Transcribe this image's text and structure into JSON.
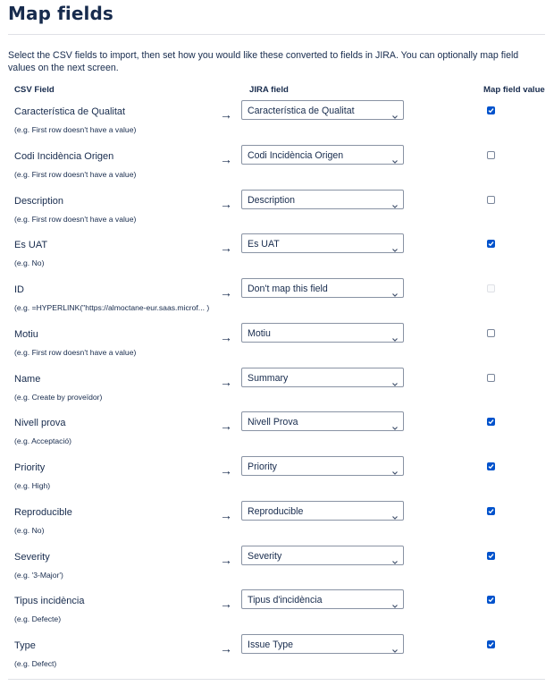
{
  "page": {
    "title": "Map fields",
    "intro": "Select the CSV fields to import, then set how you would like these converted to fields in JIRA. You can optionally map field values on the next screen."
  },
  "columns": {
    "csv": "CSV Field",
    "jira": "JIRA field",
    "map": "Map field value"
  },
  "arrow": "→",
  "rows": [
    {
      "field": "Característica de Qualitat",
      "example": "(e.g.  First row doesn't have a value)",
      "jira": "Característica de Qualitat",
      "map": true,
      "disabled": false
    },
    {
      "field": "Codi Incidència Origen",
      "example": "(e.g.  First row doesn't have a value)",
      "jira": "Codi Incidència Origen",
      "map": false,
      "disabled": false
    },
    {
      "field": "Description",
      "example": "(e.g.  First row doesn't have a value)",
      "jira": "Description",
      "map": false,
      "disabled": false
    },
    {
      "field": "Es UAT",
      "example": "(e.g.  No)",
      "jira": "Es UAT",
      "map": true,
      "disabled": false
    },
    {
      "field": "ID",
      "example": "(e.g.  =HYPERLINK(\"https://almoctane-eur.saas.microf... )",
      "jira": "Don't map this field",
      "map": false,
      "disabled": true
    },
    {
      "field": "Motiu",
      "example": "(e.g.  First row doesn't have a value)",
      "jira": "Motiu",
      "map": false,
      "disabled": false
    },
    {
      "field": "Name",
      "example": "(e.g.  Create by proveïdor)",
      "jira": "Summary",
      "map": false,
      "disabled": false
    },
    {
      "field": "Nivell prova",
      "example": "(e.g.  Acceptació)",
      "jira": "Nivell Prova",
      "map": true,
      "disabled": false
    },
    {
      "field": "Priority",
      "example": "(e.g.  High)",
      "jira": "Priority",
      "map": true,
      "disabled": false
    },
    {
      "field": "Reproducible",
      "example": "(e.g.  No)",
      "jira": "Reproducible",
      "map": true,
      "disabled": false
    },
    {
      "field": "Severity",
      "example": "(e.g.  '3-Major')",
      "jira": "Severity",
      "map": true,
      "disabled": false
    },
    {
      "field": "Tipus incidència",
      "example": "(e.g.  Defecte)",
      "jira": "Tipus d'incidència",
      "map": true,
      "disabled": false
    },
    {
      "field": "Type",
      "example": "(e.g.  Defect)",
      "jira": "Issue Type",
      "map": true,
      "disabled": false
    }
  ],
  "colors": {
    "accent": "#0052cc",
    "text": "#172b4d",
    "border": "#8993a4",
    "rule": "#dfe1e6"
  },
  "icons": {
    "select": "chevron-down-icon",
    "checkbox": "checkmark-icon"
  }
}
